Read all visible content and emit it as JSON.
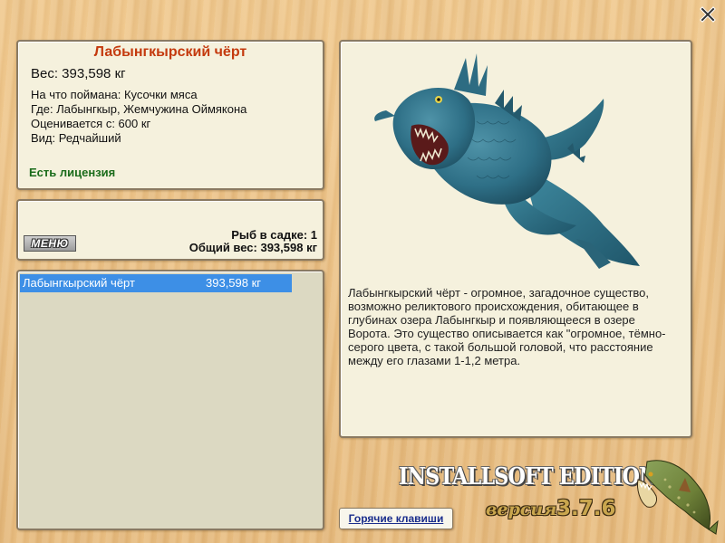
{
  "fish": {
    "title": "Лабынгкырский чёрт",
    "weight": "Вес: 393,598 кг",
    "caught_on": "На что поймана: Кусочки мяса",
    "where": "Где: Лабынгкыр, Жемчужина Оймякона",
    "valued_from": "Оценивается с: 600 кг",
    "kind": "Вид: Редчайший",
    "license": "Есть лицензия",
    "description": "Лабынгкырский чёрт - огромное, загадочное существо, возможно реликтового происхождения, обитающее в глубинах озера Лабынгкыр и появляющееся в озере Ворота. Это существо описывается как \"огромное, тёмно-серого цвета, с такой большой головой, что расстояние между его глазами 1-1,2 метра."
  },
  "catch": {
    "menu_label": "МЕНЮ",
    "fish_count": "Рыб в садке: 1",
    "total_weight": "Общий вес: 393,598 кг"
  },
  "list": {
    "rows": [
      {
        "name": "Лабынгкырский чёрт",
        "weight": "393,598 кг"
      }
    ]
  },
  "footer": {
    "edition": "INSTALLSOFT EDITION",
    "version_label": "версия",
    "version_number": "3.7.6",
    "hotkeys_label": "Горячие клавиши"
  },
  "icons": {
    "close": "close-icon",
    "creature": "creature-illustration",
    "pike": "pike-logo-icon"
  },
  "colors": {
    "title": "#c43a0e",
    "license": "#1a6b1a",
    "selection": "#3d8fe6",
    "link": "#1a2d8c"
  }
}
